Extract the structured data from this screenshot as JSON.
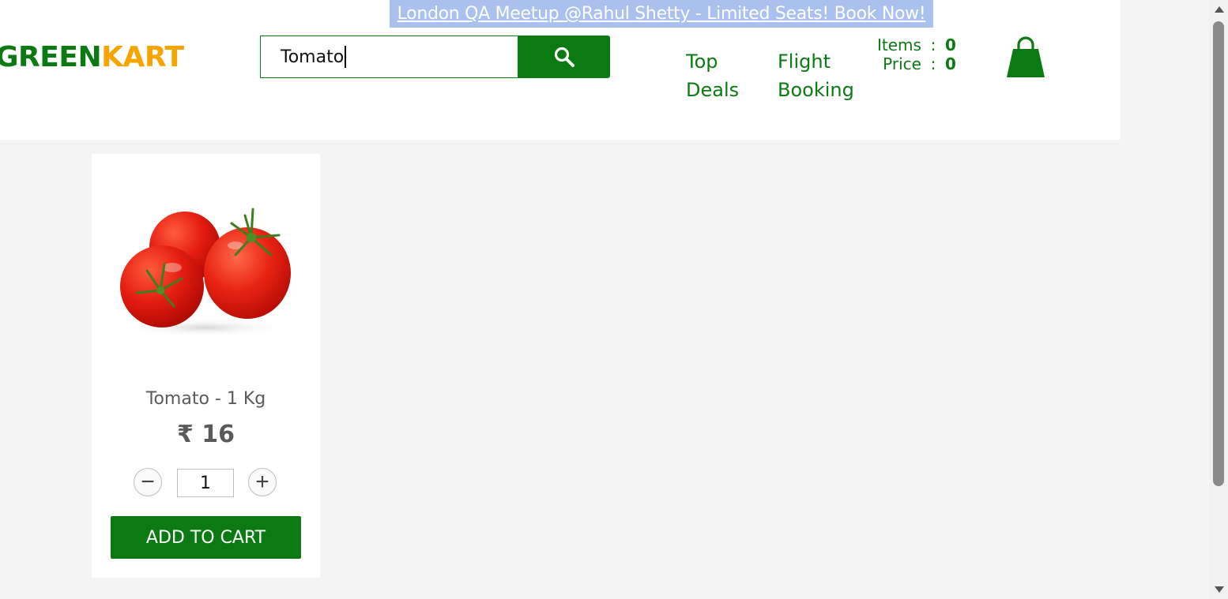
{
  "header": {
    "promo_text": "London QA Meetup @Rahul Shetty - Limited Seats! Book Now!",
    "brand_green": "GREEN",
    "brand_orange": "KART",
    "search": {
      "value": "Tomato",
      "icon": "search-icon"
    },
    "nav": {
      "top_deals_line1": "Top",
      "top_deals_line2": "Deals",
      "flight_line1": "Flight",
      "flight_line2": "Booking"
    },
    "cart": {
      "items_label": "Items",
      "items_value": "0",
      "price_label": "Price",
      "price_value": "0",
      "separator": ":",
      "icon": "shopping-bag-icon"
    }
  },
  "products": [
    {
      "name": "Tomato - 1 Kg",
      "price": "₹ 16",
      "quantity": "1",
      "decrement": "−",
      "increment": "+",
      "add_label": "ADD TO CART",
      "image_icon": "tomato-image"
    }
  ],
  "colors": {
    "brand_green": "#0b7a12",
    "brand_orange": "#f6a500",
    "banner": "#aac1f0",
    "background": "#f4f4f4"
  }
}
